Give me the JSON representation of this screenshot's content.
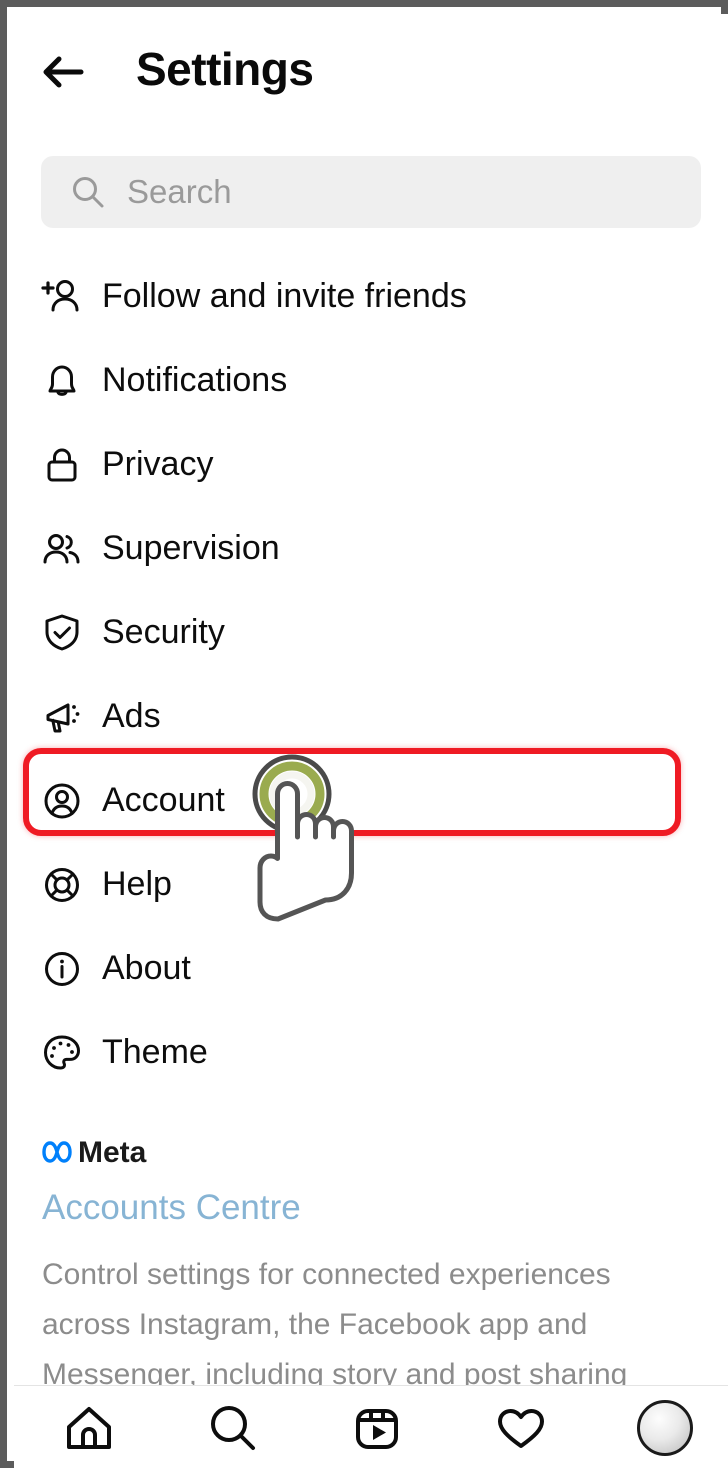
{
  "header": {
    "back_icon": "back-arrow-icon",
    "title": "Settings"
  },
  "search": {
    "icon": "search-icon",
    "placeholder": "Search",
    "value": ""
  },
  "menu": {
    "items": [
      {
        "label": "Follow and invite friends",
        "icon": "person-plus-icon"
      },
      {
        "label": "Notifications",
        "icon": "bell-icon"
      },
      {
        "label": "Privacy",
        "icon": "lock-icon"
      },
      {
        "label": "Supervision",
        "icon": "people-icon"
      },
      {
        "label": "Security",
        "icon": "shield-check-icon"
      },
      {
        "label": "Ads",
        "icon": "megaphone-icon"
      },
      {
        "label": "Account",
        "icon": "person-circle-icon"
      },
      {
        "label": "Help",
        "icon": "lifebuoy-icon"
      },
      {
        "label": "About",
        "icon": "info-circle-icon"
      },
      {
        "label": "Theme",
        "icon": "palette-icon"
      }
    ]
  },
  "highlight": {
    "target_label": "Account",
    "color": "#ef1b24"
  },
  "cursor": {
    "type": "tap-hand-cursor",
    "ring_outer_color": "#4a4a4a",
    "ring_inner_color": "#9aab4f"
  },
  "meta": {
    "logo_icon": "meta-infinity-icon",
    "logo_color": "#0080fb",
    "wordmark": "Meta",
    "link_label": "Accounts Centre",
    "link_color": "#87b4d4",
    "description": "Control settings for connected experiences across Instagram, the Facebook app and Messenger, including story and post sharing"
  },
  "bottom_nav": {
    "items": [
      {
        "name": "home",
        "icon": "home-icon"
      },
      {
        "name": "search",
        "icon": "search-icon"
      },
      {
        "name": "reels",
        "icon": "reels-icon"
      },
      {
        "name": "activity",
        "icon": "heart-icon"
      },
      {
        "name": "profile",
        "icon": "avatar-icon"
      }
    ]
  }
}
